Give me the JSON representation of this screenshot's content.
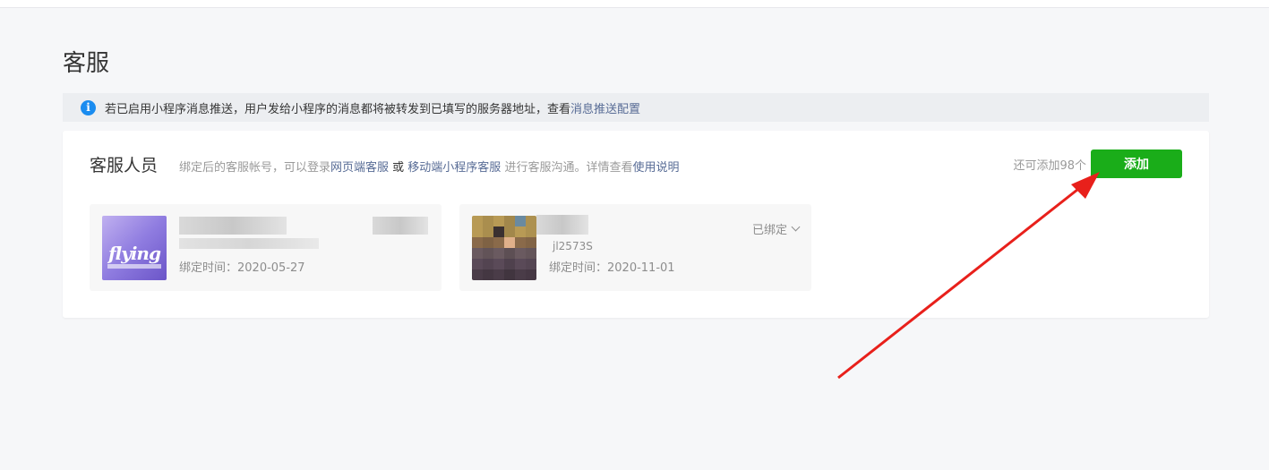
{
  "page": {
    "title": "客服"
  },
  "tip": {
    "icon": "info-icon",
    "icon_glyph": "i",
    "text": "若已启用小程序消息推送，用户发给小程序的消息都将被转发到已填写的服务器地址，查看 ",
    "link": "消息推送配置"
  },
  "staff": {
    "title": "客服人员",
    "desc_1": "绑定后的客服帐号，可以登录",
    "link_web": "网页端客服",
    "desc_2": " 或 ",
    "link_mobile": "移动端小程序客服",
    "desc_3": " 进行客服沟通。详情查看",
    "link_help": "使用说明",
    "remaining": "还可添加98个",
    "add_button": "添加",
    "agents": [
      {
        "avatar_icon": "avatar-music-logo",
        "avatar_text": "flying",
        "bind_time": "绑定时间：2020-05-27"
      },
      {
        "avatar_icon": "avatar-photo",
        "wechat_id_partial": "jl2573S",
        "bind_time": "绑定时间：2020-11-01",
        "status": "已绑定"
      }
    ]
  },
  "colors": {
    "accent_green": "#1aad19",
    "link_blue": "#576b95",
    "info_blue": "#1a8cf0",
    "annotation_red": "#e8201b"
  }
}
